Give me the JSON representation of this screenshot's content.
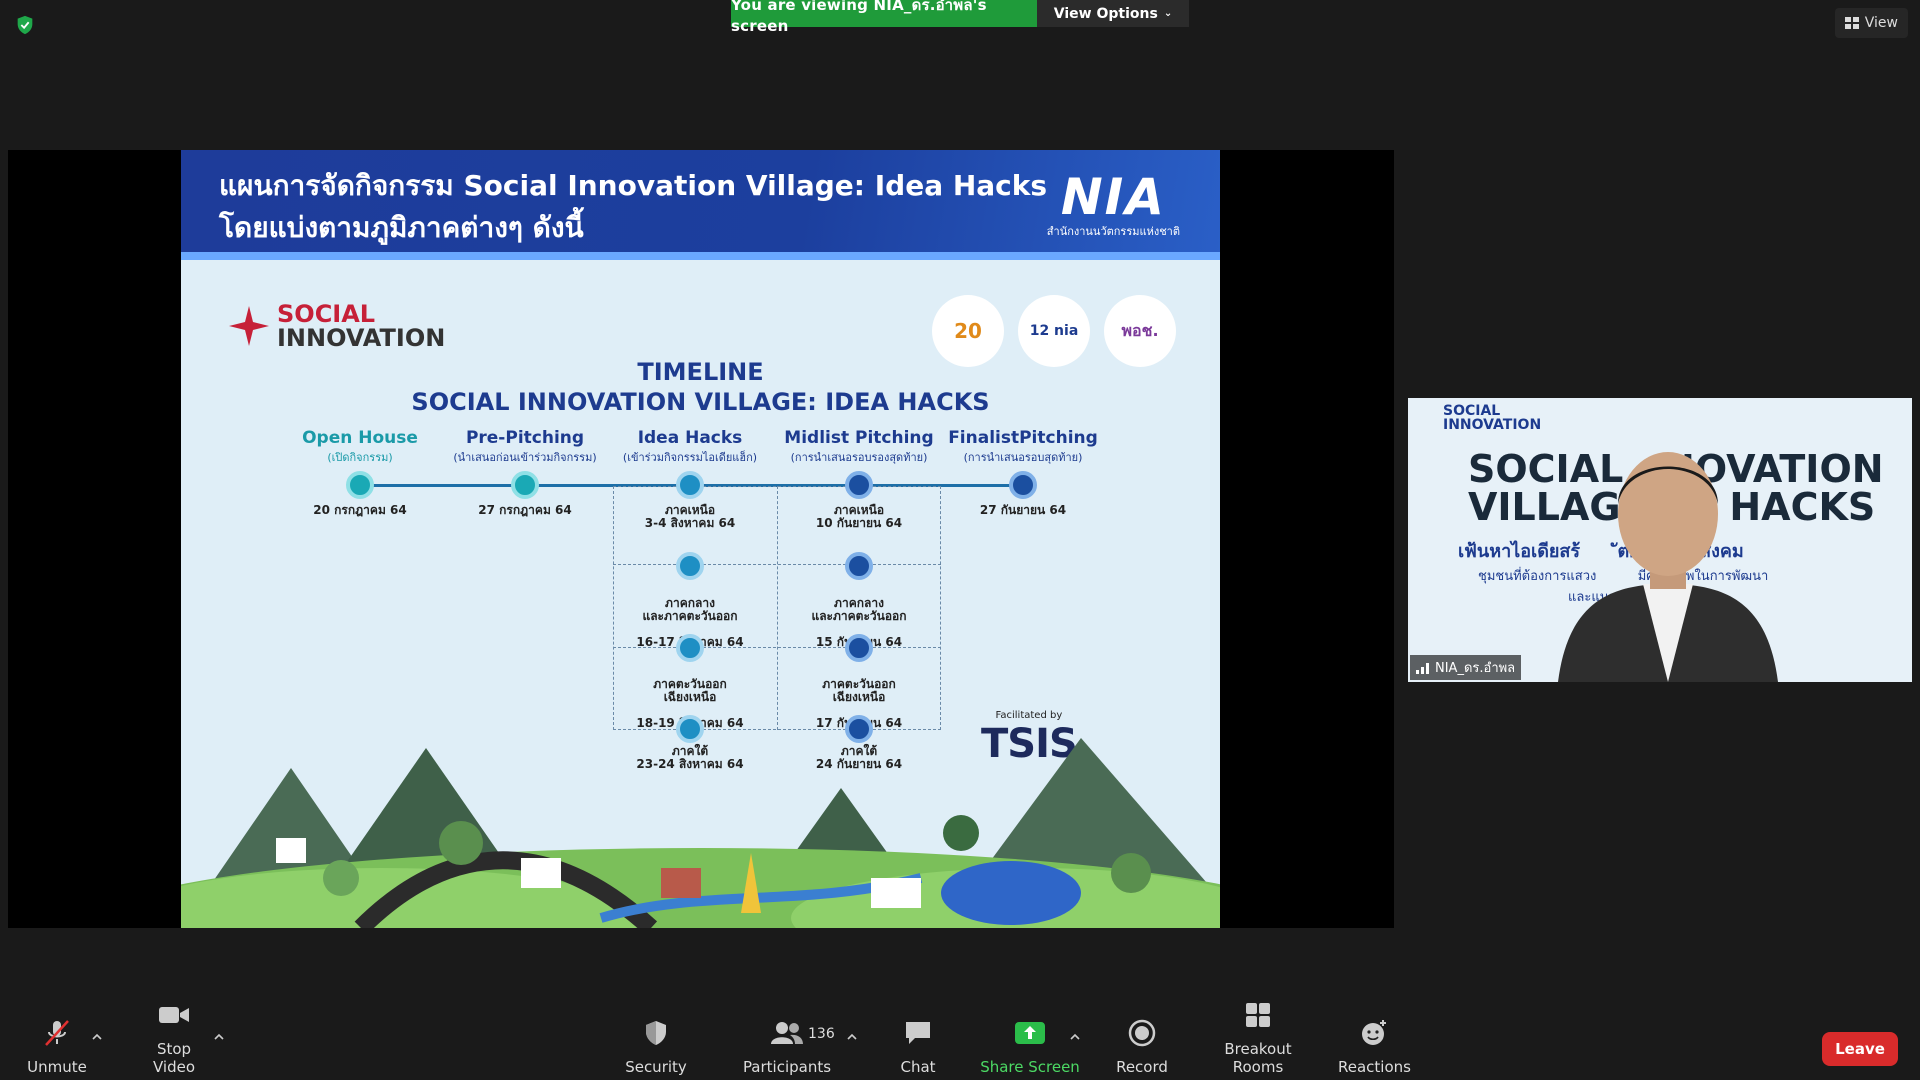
{
  "banner": {
    "sharing_text": "You are viewing NIA_ดร.อำพล's screen",
    "view_options": "View Options"
  },
  "top_right": {
    "view": "View"
  },
  "slide": {
    "title_line1": "แผนการจัดกิจกรรม Social Innovation Village: Idea Hacks",
    "title_line2": "โดยแบ่งตามภูมิภาคต่างๆ ดังนี้",
    "nia_logo": "NIA",
    "nia_sub": "สำนักงานนวัตกรรมแห่งชาติ",
    "si_logo_line1": "SOCIAL",
    "si_logo_line2": "INNOVATION",
    "badges": [
      "20",
      "12 nia",
      "พอช."
    ],
    "timeline_title1": "TIMELINE",
    "timeline_title2": "SOCIAL INNOVATION VILLAGE: IDEA HACKS",
    "stages": [
      {
        "name": "Open House",
        "sub": "(เปิดกิจกรรม)",
        "date": "20 กรกฎาคม 64"
      },
      {
        "name": "Pre-Pitching",
        "sub": "(นำเสนอก่อนเข้าร่วมกิจกรรม)",
        "date": "27 กรกฎาคม 64"
      },
      {
        "name": "Idea Hacks",
        "sub": "(เข้าร่วมกิจกรรมไอเดียแฮ็ก)"
      },
      {
        "name": "Midlist Pitching",
        "sub": "(การนำเสนอรอบรองสุดท้าย)"
      },
      {
        "name": "FinalistPitching",
        "sub": "(การนำเสนอรอบสุดท้าย)",
        "date": "27 กันยายน 64"
      }
    ],
    "idea_hacks_dates": [
      {
        "region": "ภาคเหนือ",
        "date": "3-4 สิงหาคม 64"
      },
      {
        "region": "ภาคกลาง\nและภาคตะวันออก",
        "date": "16-17 สิงหาคม 64"
      },
      {
        "region": "ภาคตะวันออก\nเฉียงเหนือ",
        "date": "18-19 สิงหาคม 64"
      },
      {
        "region": "ภาคใต้",
        "date": "23-24 สิงหาคม 64"
      }
    ],
    "midlist_dates": [
      {
        "region": "ภาคเหนือ",
        "date": "10 กันยายน 64"
      },
      {
        "region": "ภาคกลาง\nและภาคตะวันออก",
        "date": "15 กันยายน 64"
      },
      {
        "region": "ภาคตะวันออก\nเฉียงเหนือ",
        "date": "17 กันยายน 64"
      },
      {
        "region": "ภาคใต้",
        "date": "24 กันยายน 64"
      }
    ],
    "facilitated_by": "Facilitated by",
    "tsis": "TSIS"
  },
  "video": {
    "bg_logo": "SOCIAL\nINNOVATION",
    "bg_title_line1": "SOCIAL   NOVATION",
    "bg_title_line2": "VILLAG     A HACKS",
    "bg_sub1": "เฟ้นหาไอเดียสร้      ัตกรรมเพื่อสังคม",
    "bg_sub2": "ชุมชนที่ต้องการแสวง          มีศักยภาพในการพัฒนา",
    "bg_sub3": "และแนวท         ญหาชุมชน",
    "participant_name": "NIA_ดร.อำพล"
  },
  "toolbar": {
    "unmute": "Unmute",
    "stop_video": "Stop Video",
    "security": "Security",
    "participants": "Participants",
    "participant_count": "136",
    "chat": "Chat",
    "share_screen": "Share Screen",
    "record": "Record",
    "breakout_rooms": "Breakout Rooms",
    "reactions": "Reactions",
    "leave": "Leave"
  }
}
